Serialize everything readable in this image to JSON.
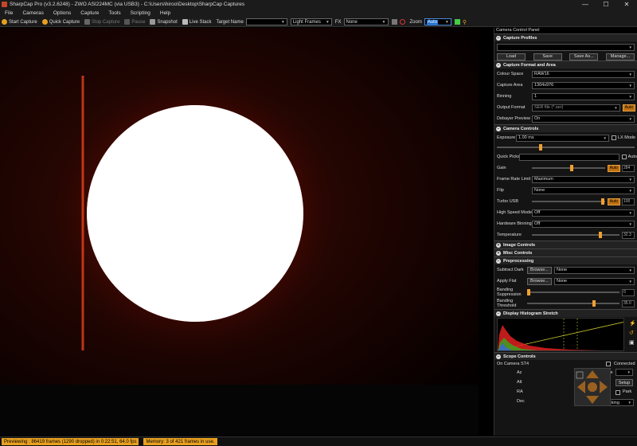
{
  "window": {
    "title": "SharpCap Pro (v3.2.6248) - ZWO ASI224MC (via USB3) - C:\\Users\\hiroo\\Desktop\\SharpCap Captures",
    "min": "—",
    "max": "☐",
    "close": "✕"
  },
  "menu": [
    "File",
    "Cameras",
    "Options",
    "Capture",
    "Tools",
    "Scripting",
    "Help"
  ],
  "toolbar": {
    "start_capture": "Start Capture",
    "quick_capture": "Quick Capture",
    "stop_capture": "Stop Capture",
    "pause": "Pause",
    "snapshot": "Snapshot",
    "live_stack": "Live Stack",
    "target_name_label": "Target Name",
    "target_name_value": "",
    "frame_type": "Light Frames",
    "fx_label": "FX",
    "fx_value": "None",
    "zoom_label": "Zoom",
    "zoom_value": "Auto"
  },
  "panel": {
    "title": "Camera Control Panel",
    "capture_profiles": {
      "header": "Capture Profiles",
      "profile_value": "",
      "load": "Load",
      "save": "Save",
      "save_as": "Save As...",
      "manage": "Manage..."
    },
    "capture_format": {
      "header": "Capture Format and Area",
      "colour_space_label": "Colour Space",
      "colour_space": "RAW16",
      "capture_area_label": "Capture Area",
      "capture_area": "1304x976",
      "binning_label": "Binning",
      "binning": "1",
      "output_format_label": "Output Format",
      "output_format": "SER file (*.ser)",
      "output_auto": "Auto",
      "debayer_label": "Debayer Preview",
      "debayer": "On"
    },
    "camera_controls": {
      "header": "Camera Controls",
      "exposure_label": "Exposure",
      "exposure_value": "1.00 ms",
      "lx_mode": "LX Mode",
      "quick_picks_label": "Quick Picks",
      "quick_picks_auto": "Auto",
      "gain_label": "Gain",
      "gain_auto": "Auto",
      "gain_value": "284",
      "frame_rate_label": "Frame Rate Limit",
      "frame_rate": "Maximum",
      "flip_label": "Flip",
      "flip": "None",
      "turbo_label": "Turbo USB",
      "turbo_auto": "Auto",
      "turbo_value": "100",
      "high_speed_label": "High Speed Mode",
      "high_speed": "Off",
      "hw_binning_label": "Hardware Binning",
      "hw_binning": "Off",
      "temp_label": "Temperature",
      "temp_value": "32.3",
      "gain_pct": 0.55,
      "exposure_pct": 0.32,
      "turbo_pct": 0.97,
      "temp_pct": 0.78
    },
    "image_controls": {
      "header": "Image Controls"
    },
    "misc_controls": {
      "header": "Misc Controls"
    },
    "preprocessing": {
      "header": "Preprocessing",
      "subtract_dark_label": "Subtract Dark",
      "subtract_dark_browse": "Browse...",
      "subtract_dark": "None",
      "apply_flat_label": "Apply Flat",
      "apply_flat_browse": "Browse...",
      "apply_flat": "None",
      "banding_supp_label": "Banding Suppression",
      "banding_supp_value": "0",
      "banding_thresh_label": "Banding Threshold",
      "banding_thresh_value": "35.0",
      "banding_supp_pct": 0.02,
      "banding_thresh_pct": 0.72
    },
    "histogram": {
      "header": "Display Histogram Stretch"
    },
    "scope": {
      "header": "Scope Controls",
      "scope_name": "On Camera ST4",
      "connected": "Connected",
      "az_label": "Az",
      "alt_label": "Alt",
      "ra_label": "RA",
      "dec_label": "Dec",
      "rate_label": "Rate",
      "setup": "Setup",
      "park": "Park",
      "tracking": "Tracking"
    }
  },
  "status": {
    "left": "Previewing : 86419 frames (1290 dropped) in 0:22:51, 64.0 fps",
    "right": "Memory: 3 of 421 frames in use."
  },
  "colors": {
    "accent": "#e8a020",
    "background": "#000000",
    "panel": "#141414"
  }
}
